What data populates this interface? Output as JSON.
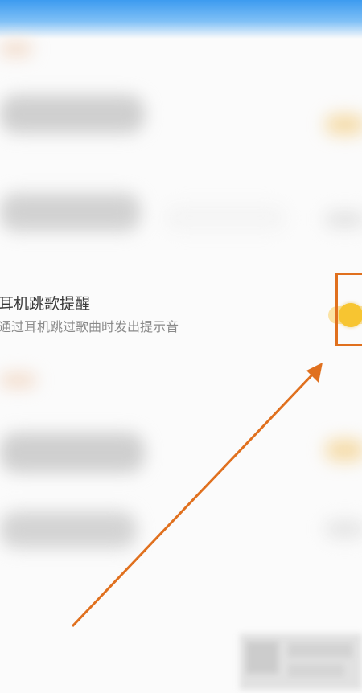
{
  "setting": {
    "title": "耳机跳歌提醒",
    "subtitle": "通过耳机跳过歌曲时发出提示音",
    "toggle": {
      "state": "on",
      "accent": "#f7c531"
    }
  },
  "annotation": {
    "color": "#e0701e"
  },
  "icons": {
    "arrow": "arrow-annotation-icon",
    "toggle": "toggle-switch"
  }
}
